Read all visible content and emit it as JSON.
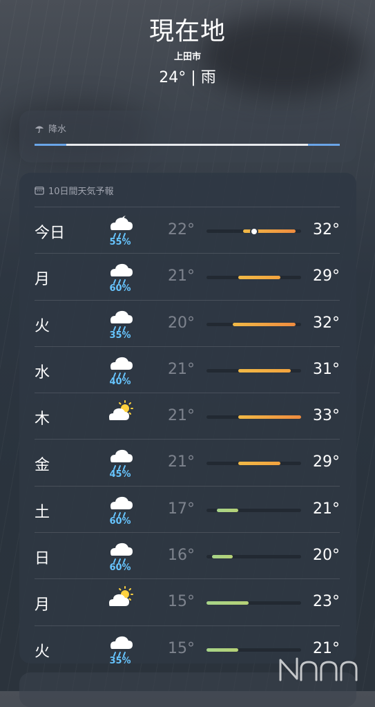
{
  "header": {
    "location": "現在地",
    "city": "上田市",
    "temp_condition": "24° | 雨"
  },
  "precipitation": {
    "title": "降水",
    "icon": "umbrella-icon"
  },
  "forecast": {
    "title": "10日間天気予報",
    "icon": "calendar-icon",
    "range": [
      15,
      33
    ],
    "days": [
      {
        "day": "今日",
        "icon": "cloud-moon-rain-icon",
        "pop": "55%",
        "low": "22°",
        "high": "32°",
        "low_value": 22,
        "high_value": 32,
        "current_value": 24
      },
      {
        "day": "月",
        "icon": "cloud-rain-icon",
        "pop": "60%",
        "low": "21°",
        "high": "29°",
        "low_value": 21,
        "high_value": 29
      },
      {
        "day": "火",
        "icon": "cloud-rain-icon",
        "pop": "35%",
        "low": "20°",
        "high": "32°",
        "low_value": 20,
        "high_value": 32
      },
      {
        "day": "水",
        "icon": "cloud-rain-icon",
        "pop": "40%",
        "low": "21°",
        "high": "31°",
        "low_value": 21,
        "high_value": 31
      },
      {
        "day": "木",
        "icon": "partly-sunny-icon",
        "pop": "",
        "low": "21°",
        "high": "33°",
        "low_value": 21,
        "high_value": 33
      },
      {
        "day": "金",
        "icon": "cloud-rain-icon",
        "pop": "45%",
        "low": "21°",
        "high": "29°",
        "low_value": 21,
        "high_value": 29
      },
      {
        "day": "土",
        "icon": "cloud-rain-icon",
        "pop": "60%",
        "low": "17°",
        "high": "21°",
        "low_value": 17,
        "high_value": 21
      },
      {
        "day": "日",
        "icon": "cloud-rain-icon",
        "pop": "60%",
        "low": "16°",
        "high": "20°",
        "low_value": 16,
        "high_value": 20
      },
      {
        "day": "月",
        "icon": "partly-sunny-icon",
        "pop": "",
        "low": "15°",
        "high": "23°",
        "low_value": 15,
        "high_value": 23
      },
      {
        "day": "火",
        "icon": "cloud-rain-icon",
        "pop": "35%",
        "low": "15°",
        "high": "21°",
        "low_value": 15,
        "high_value": 21
      }
    ]
  },
  "colors": {
    "pop": "#67c5ff",
    "cool": "#a7d489",
    "warm": "#f1b946",
    "hot": "#ef8c3f"
  }
}
